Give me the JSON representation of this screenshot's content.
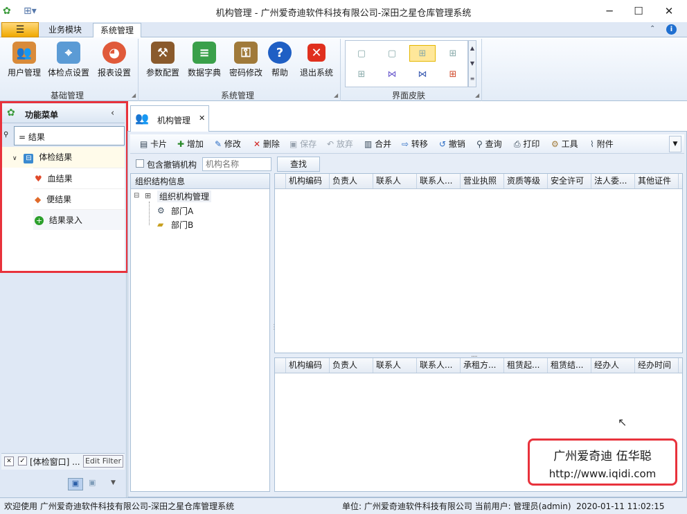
{
  "window": {
    "title": "机构管理 - 广州爱奇迪软件科技有限公司-深田之星仓库管理系统",
    "minimize": "─",
    "maximize": "☐",
    "close": "✕"
  },
  "menu": {
    "tabs": [
      {
        "label": "业务模块"
      },
      {
        "label": "系统管理"
      }
    ]
  },
  "ribbon": {
    "groups": [
      {
        "label": "基础管理",
        "items": [
          {
            "label": "用户管理"
          },
          {
            "label": "体检点设置"
          },
          {
            "label": "报表设置"
          }
        ]
      },
      {
        "label": "系统管理",
        "items": [
          {
            "label": "参数配置"
          },
          {
            "label": "数据字典"
          },
          {
            "label": "密码修改"
          },
          {
            "label": "帮助"
          },
          {
            "label": "退出系统"
          }
        ]
      },
      {
        "label": "界面皮肤"
      }
    ]
  },
  "left_panel": {
    "title": "功能菜单",
    "filter_value": "= 结果",
    "tree": {
      "parent": "体检结果",
      "children": [
        {
          "label": "血结果"
        },
        {
          "label": "便结果"
        },
        {
          "label": "结果录入"
        }
      ]
    },
    "bottom_filter": {
      "text": "[体检窗口] ...",
      "edit_filter": "Edit Filter"
    }
  },
  "document": {
    "tab_label": "机构管理",
    "toolbar": [
      {
        "label": "卡片"
      },
      {
        "label": "增加"
      },
      {
        "label": "修改"
      },
      {
        "label": "删除"
      },
      {
        "label": "保存"
      },
      {
        "label": "放弃"
      },
      {
        "label": "合并"
      },
      {
        "label": "转移"
      },
      {
        "label": "撤销"
      },
      {
        "label": "查询"
      },
      {
        "label": "打印"
      },
      {
        "label": "工具"
      },
      {
        "label": "附件"
      }
    ],
    "search": {
      "checkbox_label": "包含撤销机构",
      "placeholder": "机构名称",
      "button": "查找"
    },
    "org_panel": {
      "header": "组织结构信息",
      "root": "组织机构管理",
      "children": [
        {
          "label": "部门A"
        },
        {
          "label": "部门B"
        }
      ]
    },
    "grid_top_columns": [
      "机构编码",
      "负责人",
      "联系人",
      "联系人...",
      "营业执照",
      "资质等级",
      "安全许可",
      "法人委...",
      "其他证件"
    ],
    "grid_bottom_columns": [
      "机构编码",
      "负责人",
      "联系人",
      "联系人...",
      "承租方...",
      "租赁起...",
      "租赁结...",
      "经办人",
      "经办时间"
    ]
  },
  "watermark": {
    "line1": "广州爱奇迪  伍华聪",
    "line2": "http://www.iqidi.com"
  },
  "status": {
    "welcome": "欢迎使用 广州爱奇迪软件科技有限公司-深田之星仓库管理系统",
    "right": "单位: 广州爱奇迪软件科技有限公司 当前用户: 管理员(admin)  2020-01-11 11:02:15"
  },
  "colors": {
    "highlight_border": "#e8323c",
    "accent": "#2b6cc4"
  }
}
